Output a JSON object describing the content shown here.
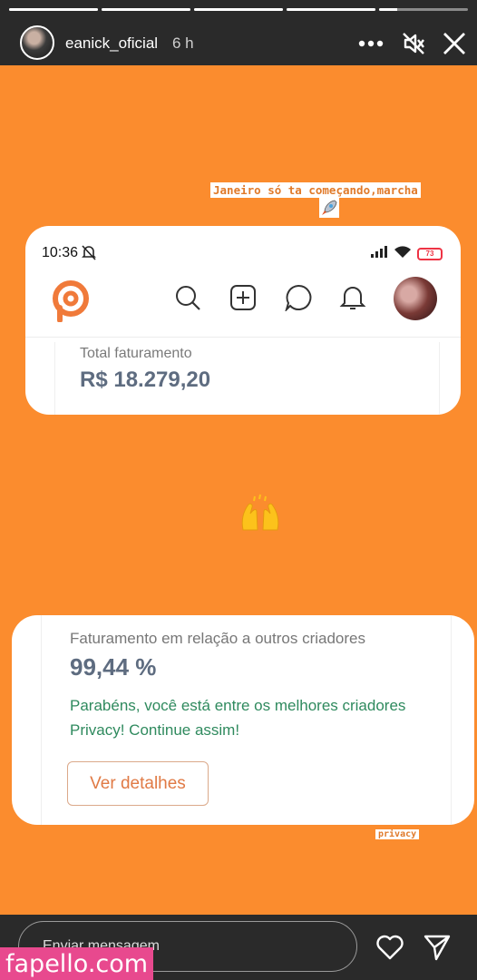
{
  "story": {
    "username": "eanick_oficial",
    "time_ago": "6 h",
    "progress": [
      1,
      1,
      1,
      1,
      0.2
    ],
    "background_color": "#fb8c2e",
    "caption": "Janeiro só ta começando,marcha",
    "sticker_tag": "privacy"
  },
  "card_top": {
    "status_time": "10:36",
    "battery": "73",
    "total_label": "Total faturamento",
    "total_value": "R$ 18.279,20"
  },
  "card_bottom": {
    "rank_label": "Faturamento em relação a outros criadores",
    "rank_value": "99,44 %",
    "congrats": "Parabéns, você está entre os melhores criadores Privacy! Continue assim!",
    "details_button": "Ver detalhes"
  },
  "bottom": {
    "message_placeholder": "Enviar mensagem",
    "watermark": "fapello.com"
  },
  "colors": {
    "accent": "#fb8c2e",
    "brand": "#f07a3a",
    "success_text": "#2f8a5e",
    "value_text": "#5e6c80"
  }
}
